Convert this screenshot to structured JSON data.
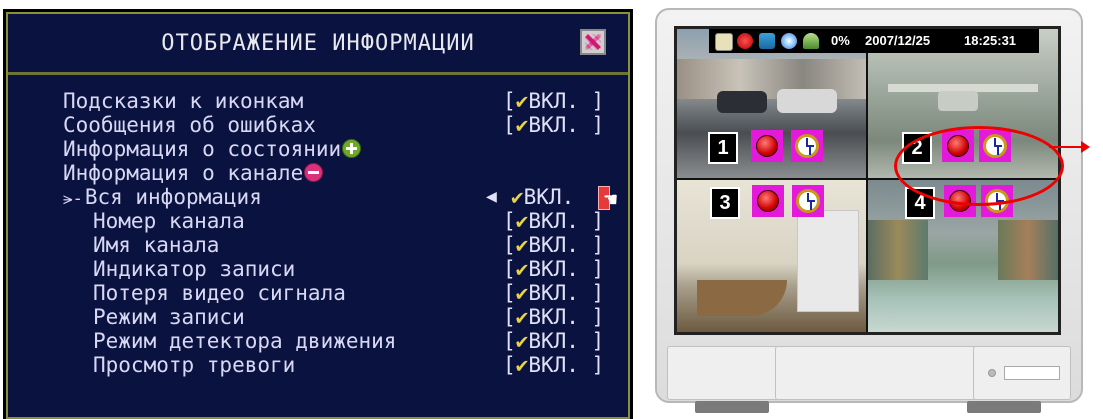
{
  "osd": {
    "title": "ОТОБРАЖЕНИЕ ИНФОРМАЦИИ",
    "close_icon": "close-icon",
    "items": [
      {
        "label": "Подсказки к иконкам",
        "check": "✔",
        "value": "ВКЛ.",
        "open": "[",
        "close": "]"
      },
      {
        "label": "Сообщения об ошибках",
        "check": "✔",
        "value": "ВКЛ.",
        "open": "[",
        "close": "]"
      },
      {
        "label": "Информация о состоянии",
        "icon": "plus-icon"
      },
      {
        "label": "Информация о канале",
        "icon": "minus-icon"
      },
      {
        "label": "Вся информация",
        "check": "✔",
        "value": "ВКЛ.",
        "arrow": "◀",
        "icon": "tree-icon"
      },
      {
        "label": "Номер канала",
        "check": "✔",
        "value": "ВКЛ.",
        "open": "[",
        "close": "]"
      },
      {
        "label": "Имя канала",
        "check": "✔",
        "value": "ВКЛ.",
        "open": "[",
        "close": "]"
      },
      {
        "label": "Индикатор записи",
        "check": "✔",
        "value": "ВКЛ.",
        "open": "[",
        "close": "]"
      },
      {
        "label": "Потеря видео сигнала",
        "check": "✔",
        "value": "ВКЛ.",
        "open": "[",
        "close": "]"
      },
      {
        "label": "Режим записи",
        "check": "✔",
        "value": "ВКЛ.",
        "open": "[",
        "close": "]"
      },
      {
        "label": "Режим детектора движения",
        "check": "✔",
        "value": "ВКЛ.",
        "open": "[",
        "close": "]"
      },
      {
        "label": "Просмотр тревоги",
        "check": "✔",
        "value": "ВКЛ.",
        "open": "[",
        "close": "]"
      }
    ]
  },
  "monitor": {
    "status": {
      "percent": "0%",
      "date": "2007/12/25",
      "time": "18:25:31",
      "icons": [
        "disk-icon",
        "record-icon",
        "network-icon",
        "cd-icon",
        "user-icon"
      ]
    },
    "cameras": [
      {
        "number": "1",
        "icons": [
          "record-icon",
          "clock-icon"
        ]
      },
      {
        "number": "2",
        "icons": [
          "record-icon",
          "clock-icon"
        ]
      },
      {
        "number": "3",
        "icons": [
          "record-icon",
          "clock-icon"
        ]
      },
      {
        "number": "4",
        "icons": [
          "record-icon",
          "clock-icon"
        ]
      }
    ]
  }
}
